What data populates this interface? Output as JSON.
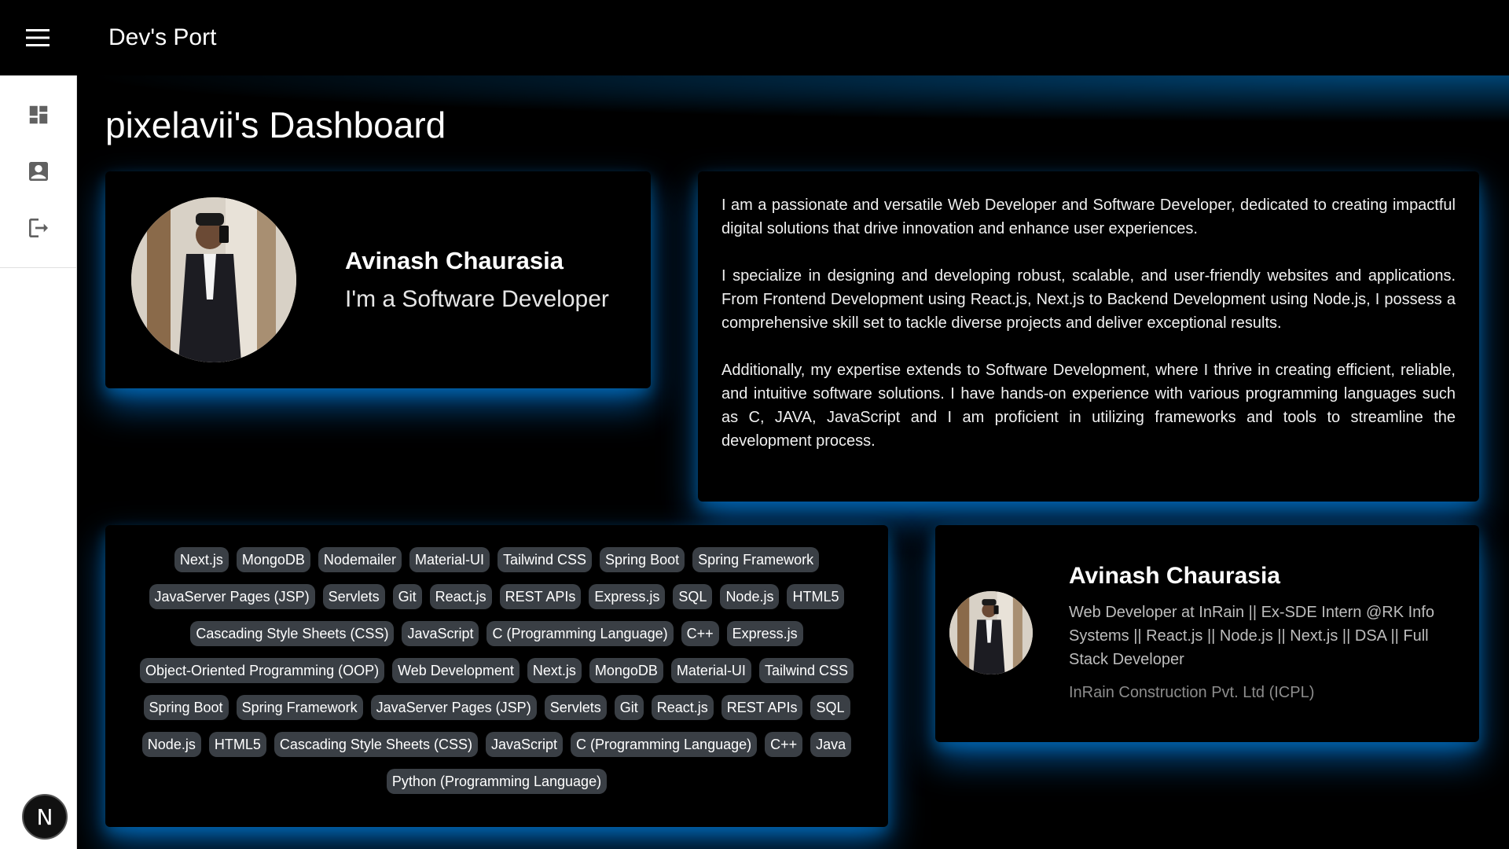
{
  "app": {
    "title": "Dev's Port"
  },
  "sidebar": {
    "items": [
      {
        "icon": "dashboard-icon",
        "label": "Dashboard"
      },
      {
        "icon": "profile-icon",
        "label": "Profile"
      },
      {
        "icon": "logout-icon",
        "label": "Logout"
      }
    ],
    "avatar_letter": "N"
  },
  "page": {
    "title": "pixelavii's Dashboard"
  },
  "profile": {
    "name": "Avinash Chaurasia",
    "role": "I'm a Software Developer"
  },
  "about": {
    "paragraphs": [
      "I am a passionate and versatile Web Developer and Software Developer, dedicated to creating impactful digital solutions that drive innovation and enhance user experiences.",
      "I specialize in designing and developing robust, scalable, and user-friendly websites and applications. From Frontend Development using React.js, Next.js to Backend Development using Node.js, I possess a comprehensive skill set to tackle diverse projects and deliver exceptional results.",
      "Additionally, my expertise extends to Software Development, where I thrive in creating efficient, reliable, and intuitive software solutions. I have hands-on experience with various programming languages such as C, JAVA, JavaScript and I am proficient in utilizing frameworks and tools to streamline the development process."
    ]
  },
  "skills": [
    "Next.js",
    "MongoDB",
    "Nodemailer",
    "Material-UI",
    "Tailwind CSS",
    "Spring Boot",
    "Spring Framework",
    "JavaServer Pages (JSP)",
    "Servlets",
    "Git",
    "React.js",
    "REST APIs",
    "Express.js",
    "SQL",
    "Node.js",
    "HTML5",
    "Cascading Style Sheets (CSS)",
    "JavaScript",
    "C (Programming Language)",
    "C++",
    "Express.js",
    "Object-Oriented Programming (OOP)",
    "Web Development",
    "Next.js",
    "MongoDB",
    "Material-UI",
    "Tailwind CSS",
    "Spring Boot",
    "Spring Framework",
    "JavaServer Pages (JSP)",
    "Servlets",
    "Git",
    "React.js",
    "REST APIs",
    "SQL",
    "Node.js",
    "HTML5",
    "Cascading Style Sheets (CSS)",
    "JavaScript",
    "C (Programming Language)",
    "C++",
    "Java",
    "Python (Programming Language)"
  ],
  "experience": {
    "name": "Avinash Chaurasia",
    "headline": "Web Developer at InRain || Ex-SDE Intern @RK Info Systems || React.js || Node.js || Next.js || DSA || Full Stack Developer",
    "company": "InRain Construction Pvt. Ltd (ICPL)"
  },
  "colors": {
    "glow": "#008cff",
    "chip_bg": "#3a3f45",
    "sidebar_bg": "#ffffff",
    "icon_gray": "#616161"
  }
}
